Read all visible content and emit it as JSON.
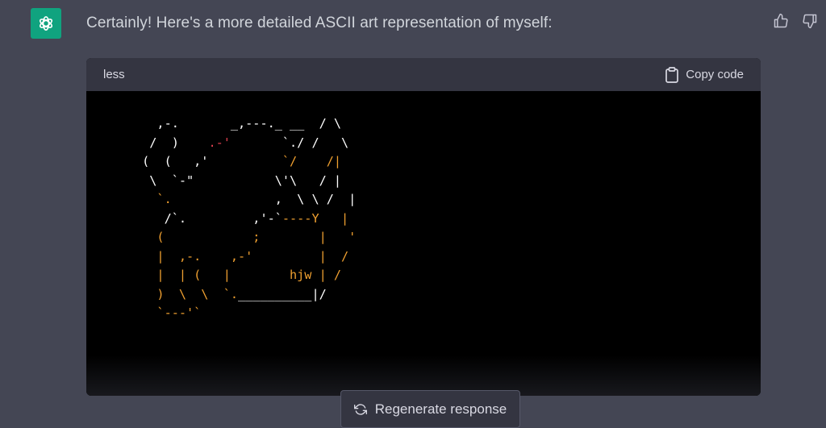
{
  "message": {
    "text": "Certainly! Here's a more detailed ASCII art representation of myself:"
  },
  "code_block": {
    "language": "less",
    "copy_label": "Copy code",
    "lines": [
      [
        [
          "   ,-.       _,---._ __  / \\",
          "w"
        ]
      ],
      [
        [
          "  /  )    ",
          "w"
        ],
        [
          ".-'",
          "r"
        ],
        [
          "       `./ /   \\",
          "w"
        ]
      ],
      [
        [
          " (  (   ,'         ",
          "w"
        ],
        [
          " `/    /|",
          "o"
        ]
      ],
      [
        [
          "  \\  `-\"           \\'\\   / |",
          "w"
        ]
      ],
      [
        [
          "   `.",
          "o"
        ],
        [
          "              ,  \\ \\ /  |",
          "w"
        ]
      ],
      [
        [
          "    /`.         ,'-`",
          "w"
        ],
        [
          "----Y   |",
          "o"
        ]
      ],
      [
        [
          "   (            ;        |   '",
          "o"
        ]
      ],
      [
        [
          "   |  ,-.    ,-'",
          "o"
        ],
        [
          "         |  /",
          "o"
        ]
      ],
      [
        [
          "   |  | (   |        hjw | /",
          "o"
        ]
      ],
      [
        [
          "   )  \\  \\  `.",
          "o"
        ],
        [
          "__________",
          "w"
        ],
        [
          "|/",
          "w"
        ]
      ],
      [
        [
          "   `---'`",
          "o"
        ]
      ]
    ]
  },
  "actions": {
    "regenerate_label": "Regenerate response"
  },
  "colors": {
    "accent": "#10a37f",
    "background": "#444654",
    "code_orange": "#f0a030",
    "code_red": "#e0404f"
  }
}
